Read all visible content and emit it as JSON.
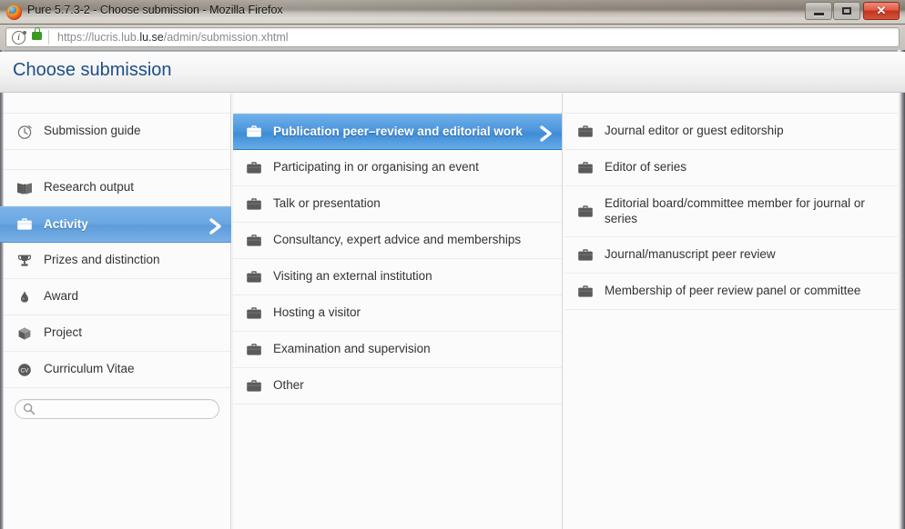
{
  "window": {
    "title": "Pure 5.7.3-2 - Choose submission - Mozilla Firefox",
    "minimize_label": "",
    "maximize_label": "",
    "close_label": "✕"
  },
  "browser": {
    "identity_label": "i",
    "url_prefix": "https://lucris.lub.",
    "url_domain": "lu.se",
    "url_suffix": "/admin/submission.xhtml"
  },
  "header": {
    "title": "Choose submission"
  },
  "colors": {
    "accent_blue": "#4e97dd",
    "sidebar_selected_blue": "#6aa7e2",
    "title_blue": "#1d4f86",
    "row_text": "#333333",
    "divider": "#ececec"
  },
  "sidebar": {
    "items": [
      {
        "label": "Submission guide",
        "icon": "clock-icon",
        "selected": false
      },
      {
        "label": "Research output",
        "icon": "book-icon",
        "selected": false
      },
      {
        "label": "Activity",
        "icon": "briefcase-icon",
        "selected": true
      },
      {
        "label": "Prizes and distinction",
        "icon": "trophy-icon",
        "selected": false
      },
      {
        "label": "Award",
        "icon": "medal-icon",
        "selected": false
      },
      {
        "label": "Project",
        "icon": "cube-icon",
        "selected": false
      },
      {
        "label": "Curriculum Vitae",
        "icon": "cv-icon",
        "selected": false
      }
    ],
    "search": {
      "value": "",
      "placeholder": ""
    }
  },
  "middle_column": {
    "items": [
      {
        "label": "Publication peer–review and editorial work",
        "icon": "briefcase-icon",
        "selected": true
      },
      {
        "label": "Participating in or organising an event",
        "icon": "briefcase-icon",
        "selected": false
      },
      {
        "label": "Talk or presentation",
        "icon": "briefcase-icon",
        "selected": false
      },
      {
        "label": "Consultancy, expert advice and memberships",
        "icon": "briefcase-icon",
        "selected": false
      },
      {
        "label": "Visiting an external institution",
        "icon": "briefcase-icon",
        "selected": false
      },
      {
        "label": "Hosting a visitor",
        "icon": "briefcase-icon",
        "selected": false
      },
      {
        "label": "Examination and supervision",
        "icon": "briefcase-icon",
        "selected": false
      },
      {
        "label": "Other",
        "icon": "briefcase-icon",
        "selected": false
      }
    ]
  },
  "right_column": {
    "items": [
      {
        "label": "Journal editor or guest editorship",
        "icon": "briefcase-icon",
        "two_line": false
      },
      {
        "label": "Editor of series",
        "icon": "briefcase-icon",
        "two_line": false
      },
      {
        "label": "Editorial board/committee member for journal or series",
        "icon": "briefcase-icon",
        "two_line": true
      },
      {
        "label": "Journal/manuscript peer review",
        "icon": "briefcase-icon",
        "two_line": false
      },
      {
        "label": "Membership of peer review panel or committee",
        "icon": "briefcase-icon",
        "two_line": false
      }
    ]
  }
}
